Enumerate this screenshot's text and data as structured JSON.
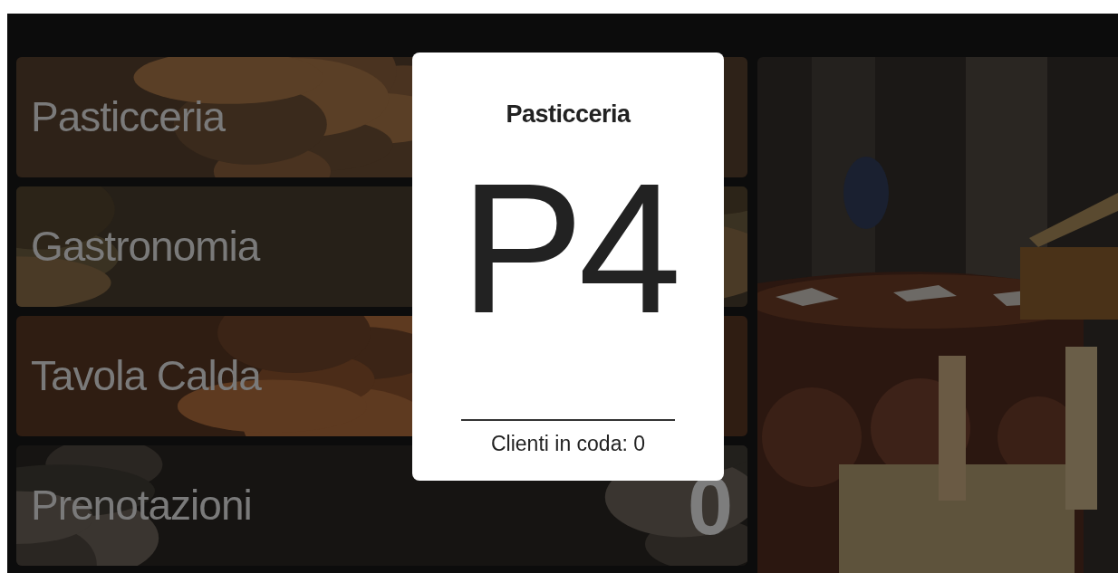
{
  "tiles": [
    {
      "label": "Pasticceria",
      "kind": "picture"
    },
    {
      "label": "Gastronomia",
      "kind": "picture"
    },
    {
      "label": "Tavola Calda",
      "kind": "picture"
    },
    {
      "label": "Prenotazioni",
      "kind": "picture",
      "count": "0"
    }
  ],
  "dialog": {
    "title": "Pasticceria",
    "code": "P4",
    "queue_text": "Clienti in coda: 0"
  }
}
